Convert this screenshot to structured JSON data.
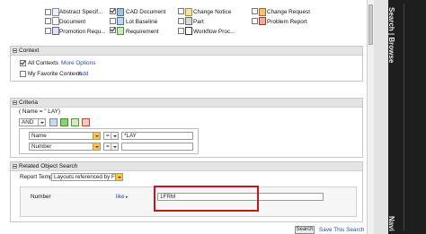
{
  "types": {
    "row1": [
      {
        "label": "Abstract Specif...",
        "checked": false
      },
      {
        "label": "CAD Document",
        "checked": true
      },
      {
        "label": "Change Notice",
        "checked": false
      },
      {
        "label": "Change Request",
        "checked": false
      }
    ],
    "row2": [
      {
        "label": "Document",
        "checked": false
      },
      {
        "label": "Lot Baseline",
        "checked": false
      },
      {
        "label": "Part",
        "checked": false
      },
      {
        "label": "Problem Report",
        "checked": false
      }
    ],
    "row3": [
      {
        "label": "Promotion Requ...",
        "checked": false
      },
      {
        "label": "Requirement",
        "checked": true
      },
      {
        "label": "Workflow Proc...",
        "checked": false
      }
    ]
  },
  "context": {
    "title": "Context",
    "all_contexts_label": "All Contexts",
    "all_contexts_checked": true,
    "more_options": "More Options",
    "my_favorites_label": "My Favorite Contexts",
    "add_link": "Add"
  },
  "criteria": {
    "title": "Criteria",
    "expression": "( Name = \" LAY)",
    "operator": "AND",
    "rows": [
      {
        "attribute": "Name",
        "op": "=",
        "value": "*LAY"
      },
      {
        "attribute": "Number",
        "op": "=",
        "value": ""
      }
    ]
  },
  "related": {
    "title": "Related Object Search",
    "template_label": "Report Template:",
    "template_value": "Layouts referenced by Fo",
    "field_label": "Number",
    "like_label": "like",
    "value": "1FRM"
  },
  "footer": {
    "search_button": "Search",
    "save_search": "Save This Search"
  },
  "side": {
    "browse_text": "Search | Browse",
    "navigator_text": "Navi"
  },
  "colors": {
    "highlight_box": "#c0181c",
    "link": "#1f4fa8",
    "nav_panel": "#1e1e1e",
    "dropdown_arrow": "#f4c35a"
  }
}
